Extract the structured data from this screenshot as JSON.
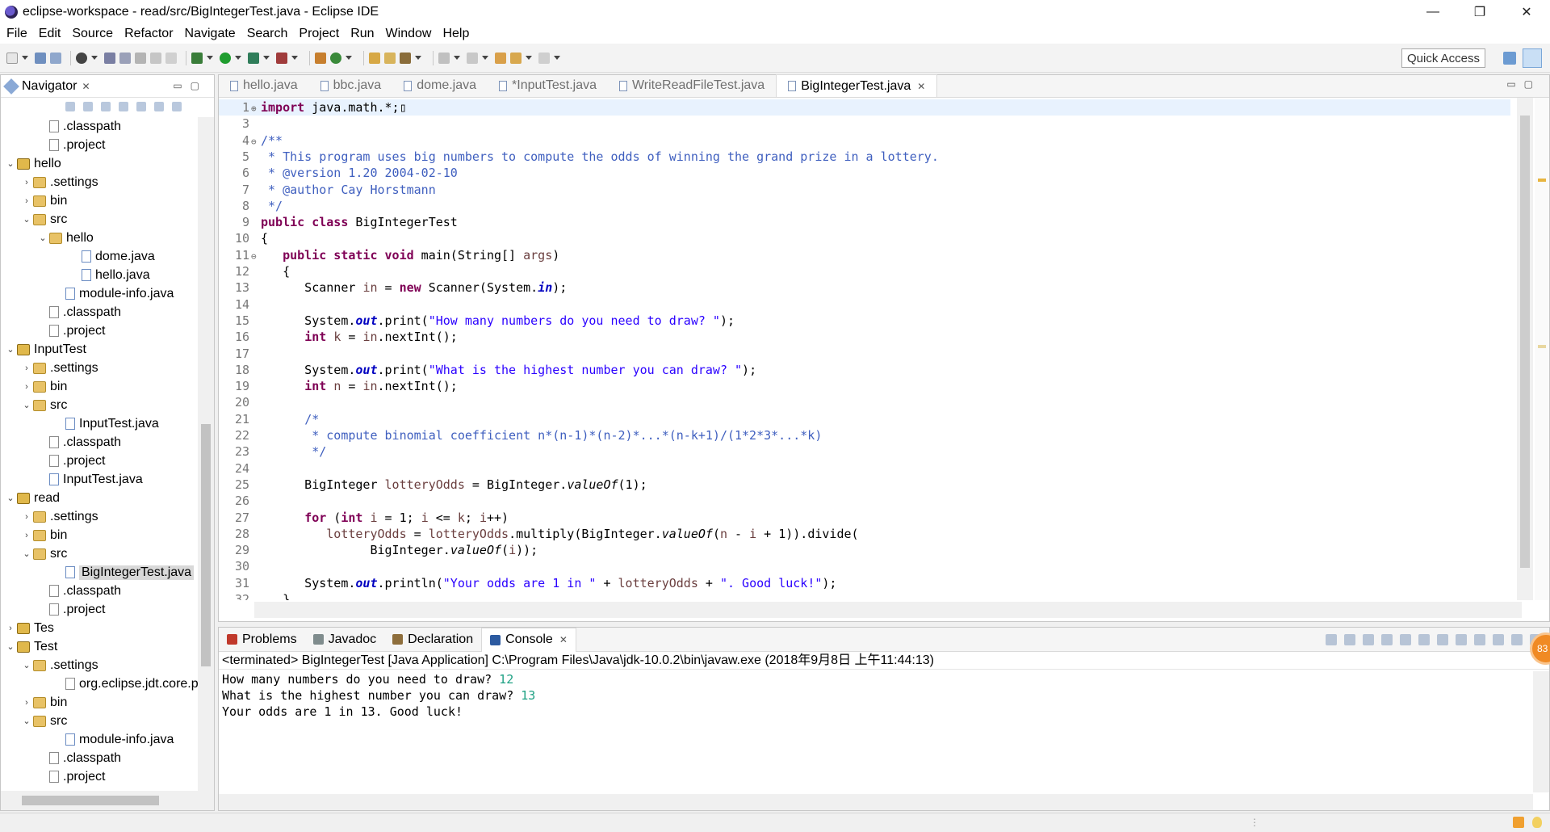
{
  "window": {
    "title": "eclipse-workspace - read/src/BigIntegerTest.java - Eclipse IDE",
    "minimize": "—",
    "maximize": "❐",
    "close": "✕"
  },
  "menu": [
    "File",
    "Edit",
    "Source",
    "Refactor",
    "Navigate",
    "Search",
    "Project",
    "Run",
    "Window",
    "Help"
  ],
  "toolbar": {
    "quick_access": "Quick Access"
  },
  "navigator": {
    "title": "Navigator",
    "tree": [
      {
        "label": ".classpath",
        "depth": 2,
        "type": "file",
        "twisty": ""
      },
      {
        "label": ".project",
        "depth": 2,
        "type": "file",
        "twisty": ""
      },
      {
        "label": "hello",
        "depth": 0,
        "type": "project",
        "twisty": "v"
      },
      {
        "label": ".settings",
        "depth": 1,
        "type": "folder",
        "twisty": ">"
      },
      {
        "label": "bin",
        "depth": 1,
        "type": "folder",
        "twisty": ">"
      },
      {
        "label": "src",
        "depth": 1,
        "type": "folder",
        "twisty": "v"
      },
      {
        "label": "hello",
        "depth": 2,
        "type": "folder",
        "twisty": "v"
      },
      {
        "label": "dome.java",
        "depth": 4,
        "type": "java",
        "twisty": ""
      },
      {
        "label": "hello.java",
        "depth": 4,
        "type": "java",
        "twisty": ""
      },
      {
        "label": "module-info.java",
        "depth": 3,
        "type": "java",
        "twisty": ""
      },
      {
        "label": ".classpath",
        "depth": 2,
        "type": "file",
        "twisty": ""
      },
      {
        "label": ".project",
        "depth": 2,
        "type": "file",
        "twisty": ""
      },
      {
        "label": "InputTest",
        "depth": 0,
        "type": "project",
        "twisty": "v"
      },
      {
        "label": ".settings",
        "depth": 1,
        "type": "folder",
        "twisty": ">"
      },
      {
        "label": "bin",
        "depth": 1,
        "type": "folder",
        "twisty": ">"
      },
      {
        "label": "src",
        "depth": 1,
        "type": "folder",
        "twisty": "v"
      },
      {
        "label": "InputTest.java",
        "depth": 3,
        "type": "java",
        "twisty": ""
      },
      {
        "label": ".classpath",
        "depth": 2,
        "type": "file",
        "twisty": ""
      },
      {
        "label": ".project",
        "depth": 2,
        "type": "file",
        "twisty": ""
      },
      {
        "label": "InputTest.java",
        "depth": 2,
        "type": "java",
        "twisty": ""
      },
      {
        "label": "read",
        "depth": 0,
        "type": "project",
        "twisty": "v"
      },
      {
        "label": ".settings",
        "depth": 1,
        "type": "folder",
        "twisty": ">"
      },
      {
        "label": "bin",
        "depth": 1,
        "type": "folder",
        "twisty": ">"
      },
      {
        "label": "src",
        "depth": 1,
        "type": "folder",
        "twisty": "v"
      },
      {
        "label": "BigIntegerTest.java",
        "depth": 3,
        "type": "java",
        "twisty": "",
        "selected": true
      },
      {
        "label": ".classpath",
        "depth": 2,
        "type": "file",
        "twisty": ""
      },
      {
        "label": ".project",
        "depth": 2,
        "type": "file",
        "twisty": ""
      },
      {
        "label": "Tes",
        "depth": 0,
        "type": "project",
        "twisty": ">"
      },
      {
        "label": "Test",
        "depth": 0,
        "type": "project",
        "twisty": "v"
      },
      {
        "label": ".settings",
        "depth": 1,
        "type": "folder",
        "twisty": "v"
      },
      {
        "label": "org.eclipse.jdt.core.p",
        "depth": 3,
        "type": "file",
        "twisty": ""
      },
      {
        "label": "bin",
        "depth": 1,
        "type": "folder",
        "twisty": ">"
      },
      {
        "label": "src",
        "depth": 1,
        "type": "folder",
        "twisty": "v"
      },
      {
        "label": "module-info.java",
        "depth": 3,
        "type": "java",
        "twisty": ""
      },
      {
        "label": ".classpath",
        "depth": 2,
        "type": "file",
        "twisty": ""
      },
      {
        "label": ".project",
        "depth": 2,
        "type": "file",
        "twisty": ""
      }
    ]
  },
  "editor": {
    "tabs": [
      {
        "label": "hello.java",
        "active": false
      },
      {
        "label": "bbc.java",
        "active": false
      },
      {
        "label": "dome.java",
        "active": false
      },
      {
        "label": "*InputTest.java",
        "active": false
      },
      {
        "label": "WriteReadFileTest.java",
        "active": false
      },
      {
        "label": "BigIntegerTest.java",
        "active": true
      }
    ],
    "lines": [
      {
        "n": "1",
        "fold": "⊕",
        "html": "<span class=\"kw\">import</span> java.math.*;▯"
      },
      {
        "n": "3",
        "fold": "",
        "html": ""
      },
      {
        "n": "4",
        "fold": "⊖",
        "html": "<span class=\"cm\">/**</span>"
      },
      {
        "n": "5",
        "fold": "",
        "html": "<span class=\"cm\"> * This program uses big numbers to compute the odds of winning the grand prize in a lottery.</span>"
      },
      {
        "n": "6",
        "fold": "",
        "html": "<span class=\"cm\"> * @version 1.20 2004-02-10</span>"
      },
      {
        "n": "7",
        "fold": "",
        "html": "<span class=\"cm\"> * @author Cay Horstmann</span>"
      },
      {
        "n": "8",
        "fold": "",
        "html": "<span class=\"cm\"> */</span>"
      },
      {
        "n": "9",
        "fold": "",
        "html": "<span class=\"kw\">public class</span> BigIntegerTest"
      },
      {
        "n": "10",
        "fold": "",
        "html": "{"
      },
      {
        "n": "11",
        "fold": "⊖",
        "html": "   <span class=\"kw\">public static void</span> main(String[] <span class=\"var\">args</span>)"
      },
      {
        "n": "12",
        "fold": "",
        "html": "   {"
      },
      {
        "n": "13",
        "fold": "",
        "html": "      Scanner <span class=\"var\">in</span> = <span class=\"kw\">new</span> Scanner(System.<span class=\"fld\">in</span>);"
      },
      {
        "n": "14",
        "fold": "",
        "html": ""
      },
      {
        "n": "15",
        "fold": "",
        "html": "      System.<span class=\"fld\">out</span>.print(<span class=\"str\">\"How many numbers do you need to draw? \"</span>);"
      },
      {
        "n": "16",
        "fold": "",
        "html": "      <span class=\"kw\">int</span> <span class=\"var\">k</span> = <span class=\"var\">in</span>.nextInt();"
      },
      {
        "n": "17",
        "fold": "",
        "html": ""
      },
      {
        "n": "18",
        "fold": "",
        "html": "      System.<span class=\"fld\">out</span>.print(<span class=\"str\">\"What is the highest number you can draw? \"</span>);"
      },
      {
        "n": "19",
        "fold": "",
        "html": "      <span class=\"kw\">int</span> <span class=\"var\">n</span> = <span class=\"var\">in</span>.nextInt();"
      },
      {
        "n": "20",
        "fold": "",
        "html": ""
      },
      {
        "n": "21",
        "fold": "",
        "html": "      <span class=\"cm\">/*</span>"
      },
      {
        "n": "22",
        "fold": "",
        "html": "<span class=\"cm\">       * compute binomial coefficient n*(n-1)*(n-2)*...*(n-k+1)/(1*2*3*...*k)</span>"
      },
      {
        "n": "23",
        "fold": "",
        "html": "<span class=\"cm\">       */</span>"
      },
      {
        "n": "24",
        "fold": "",
        "html": ""
      },
      {
        "n": "25",
        "fold": "",
        "html": "      BigInteger <span class=\"var\">lotteryOdds</span> = BigInteger.<span class=\"sfn\">valueOf</span>(1);"
      },
      {
        "n": "26",
        "fold": "",
        "html": ""
      },
      {
        "n": "27",
        "fold": "",
        "html": "      <span class=\"kw\">for</span> (<span class=\"kw\">int</span> <span class=\"var\">i</span> = 1; <span class=\"var\">i</span> &lt;= <span class=\"var\">k</span>; <span class=\"var\">i</span>++)"
      },
      {
        "n": "28",
        "fold": "",
        "html": "         <span class=\"var\">lotteryOdds</span> = <span class=\"var\">lotteryOdds</span>.multiply(BigInteger.<span class=\"sfn\">valueOf</span>(<span class=\"var\">n</span> - <span class=\"var\">i</span> + 1)).divide("
      },
      {
        "n": "29",
        "fold": "",
        "html": "               BigInteger.<span class=\"sfn\">valueOf</span>(<span class=\"var\">i</span>));"
      },
      {
        "n": "30",
        "fold": "",
        "html": ""
      },
      {
        "n": "31",
        "fold": "",
        "html": "      System.<span class=\"fld\">out</span>.println(<span class=\"str\">\"Your odds are 1 in \"</span> + <span class=\"var\">lotteryOdds</span> + <span class=\"str\">\". Good luck!\"</span>);"
      },
      {
        "n": "32",
        "fold": "",
        "html": "   }"
      }
    ]
  },
  "console": {
    "tabs": [
      {
        "label": "Problems",
        "active": false,
        "color": "#c0392b"
      },
      {
        "label": "Javadoc",
        "active": false,
        "color": "#7f8c8d"
      },
      {
        "label": "Declaration",
        "active": false,
        "color": "#8e6e3c"
      },
      {
        "label": "Console",
        "active": true,
        "color": "#2c5aa0"
      }
    ],
    "status": "<terminated> BigIntegerTest [Java Application] C:\\Program Files\\Java\\jdk-10.0.2\\bin\\javaw.exe (2018年9月8日 上午11:44:13)",
    "output": [
      {
        "text": "How many numbers do you need to draw? ",
        "input": "12"
      },
      {
        "text": "What is the highest number you can draw? ",
        "input": "13"
      },
      {
        "text": "Your odds are 1 in 13. Good luck!",
        "input": ""
      }
    ],
    "badge": "83"
  }
}
